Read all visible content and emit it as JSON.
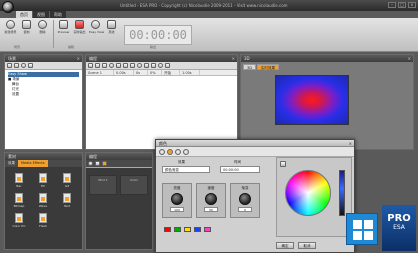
{
  "window": {
    "title": "Untitled - ESA PRO - Copyright (c) Nicolaudie 2009-2011 - Visit www.nicolaudie.com",
    "min": "–",
    "max": "□",
    "close": "×"
  },
  "ribbon": {
    "tabs": [
      "首页",
      "视图",
      "帮助"
    ],
    "active_tab": 0,
    "buttons": [
      {
        "label": "新建场景"
      },
      {
        "label": "复制"
      },
      {
        "label": "删除"
      },
      {
        "label": "Preview"
      },
      {
        "label": "实时输出"
      },
      {
        "label": "Easy View"
      },
      {
        "label": "离线"
      }
    ],
    "groups": [
      "场景",
      "编辑",
      "输出"
    ],
    "timecode": "00:00:00"
  },
  "panels": {
    "tree": {
      "title": "场景",
      "items": [
        "Easy Show",
        "■ 场景",
        "舞台",
        "灯光",
        "设置"
      ]
    },
    "cues": {
      "title": "编程",
      "columns": [
        "Scene 1",
        "0.00s",
        "0s",
        "0%",
        "开始",
        "1.00s"
      ]
    },
    "visual": {
      "title": "3D",
      "tabs": [
        "3D",
        "实时效果"
      ]
    },
    "media": {
      "title": "素材",
      "tabs": [
        "效果",
        "Media Effects"
      ],
      "files": [
        {
          "label": "Bar"
        },
        {
          "label": "Fill"
        },
        {
          "label": "Gif"
        },
        {
          "label": "Bitmap"
        },
        {
          "label": "Wave"
        },
        {
          "label": "Text"
        },
        {
          "label": "Color Pic"
        },
        {
          "label": "Flash"
        }
      ]
    },
    "program": {
      "title": "编程",
      "cols": [
        "Mod 1",
        "Color"
      ]
    }
  },
  "dialog": {
    "title": "颜色",
    "lbl_preset": "效果",
    "preset_value": "颜色渐变",
    "lbl_time": "时间",
    "time_value": "00:00:00",
    "knobs": [
      {
        "label": "亮度",
        "value": "100"
      },
      {
        "label": "速度",
        "value": "50"
      },
      {
        "label": "渐变",
        "value": "0"
      }
    ],
    "swatches": [
      "#ff0000",
      "#00b000",
      "#ffdd00",
      "#2040ff",
      "#ff40c0"
    ],
    "btn_ok": "确定",
    "btn_cancel": "取消"
  },
  "badges": {
    "pro_big": "PRO",
    "pro_small": "ESA"
  },
  "colors": {
    "accent": "#f0a030",
    "win_blue": "#1e8ad6"
  }
}
